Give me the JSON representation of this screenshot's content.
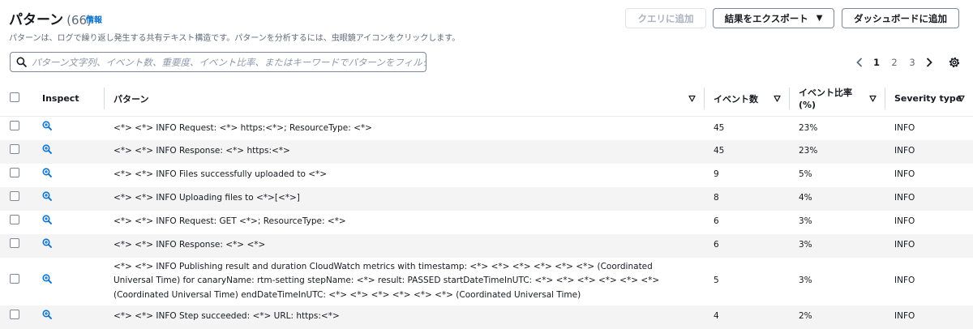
{
  "header": {
    "title": "パターン",
    "count": "(66)",
    "info": "情報",
    "description": "パターンは、ログで繰り返し発生する共有テキスト構造です。パターンを分析するには、虫眼鏡アイコンをクリックします。"
  },
  "actions": {
    "add_to_query": "クエリに追加",
    "export_results": "結果をエクスポート",
    "add_to_dashboard": "ダッシュボードに追加"
  },
  "search": {
    "placeholder": "パターン文字列、イベント数、重要度、イベント比率、またはキーワードでパターンをフィルタ",
    "value": ""
  },
  "pagination": {
    "pages": [
      "1",
      "2",
      "3"
    ],
    "current": "1"
  },
  "table": {
    "columns": {
      "inspect": "Inspect",
      "pattern": "パターン",
      "event_count": "イベント数",
      "event_ratio_line1": "イベント比率",
      "event_ratio_line2": "(%)",
      "severity": "Severity type"
    },
    "rows": [
      {
        "pattern": "<*> <*> INFO Request: <*> https:<*>; ResourceType: <*>",
        "count": "45",
        "ratio": "23%",
        "severity": "INFO"
      },
      {
        "pattern": "<*> <*> INFO Response: <*> https:<*>",
        "count": "45",
        "ratio": "23%",
        "severity": "INFO"
      },
      {
        "pattern": "<*> <*> INFO Files successfully uploaded to <*>",
        "count": "9",
        "ratio": "5%",
        "severity": "INFO"
      },
      {
        "pattern": "<*> <*> INFO Uploading files to <*>[<*>]",
        "count": "8",
        "ratio": "4%",
        "severity": "INFO"
      },
      {
        "pattern": "<*> <*> INFO Request: GET <*>; ResourceType: <*>",
        "count": "6",
        "ratio": "3%",
        "severity": "INFO"
      },
      {
        "pattern": "<*> <*> INFO Response: <*> <*>",
        "count": "6",
        "ratio": "3%",
        "severity": "INFO"
      },
      {
        "pattern": "<*> <*> INFO Publishing result and duration CloudWatch metrics with timestamp: <*> <*> <*> <*> <*> <*> (Coordinated Universal Time) for canaryName: rtm-setting stepName: <*> result: PASSED startDateTimeInUTC: <*> <*> <*> <*> <*> <*> (Coordinated Universal Time) endDateTimeInUTC: <*> <*> <*> <*> <*> <*> (Coordinated Universal Time)",
        "count": "5",
        "ratio": "3%",
        "severity": "INFO"
      },
      {
        "pattern": "<*> <*> INFO Step succeeded: <*> URL: https:<*>",
        "count": "4",
        "ratio": "2%",
        "severity": "INFO"
      }
    ]
  },
  "colors": {
    "link": "#0972d3",
    "text": "#16191f",
    "muted": "#5f6b7a",
    "row_alt": "#f4f4f4",
    "border": "#7d8998"
  },
  "icons": [
    "search-icon",
    "chevron-left-icon",
    "chevron-right-icon",
    "gear-icon",
    "filter-triangle-icon",
    "zoom-in-icon",
    "caret-down-icon"
  ]
}
